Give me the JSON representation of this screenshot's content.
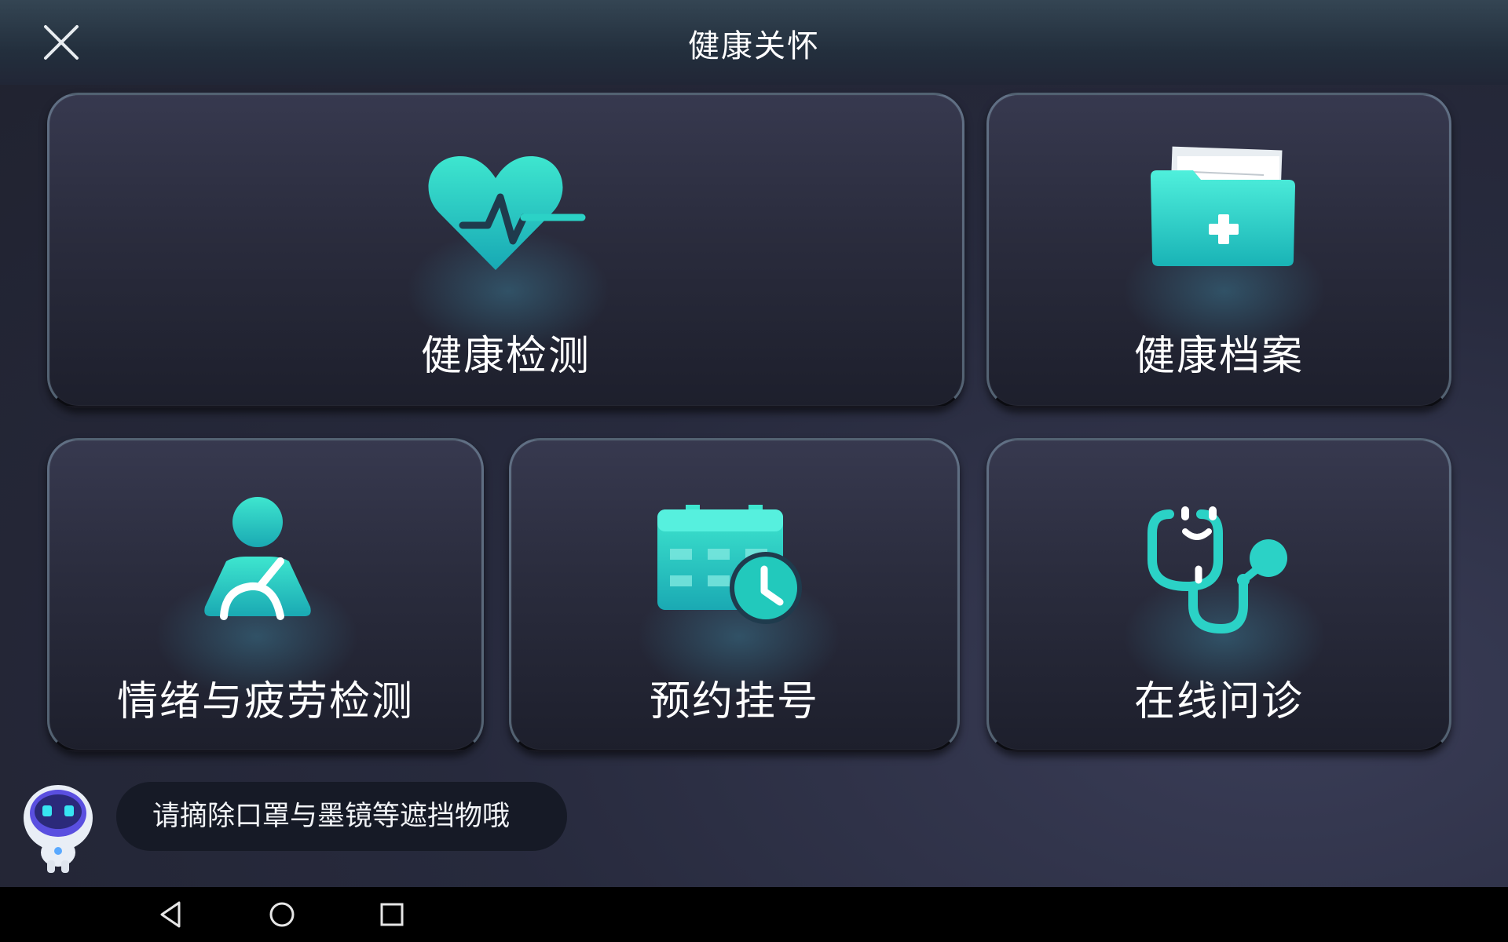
{
  "header": {
    "title": "健康关怀",
    "close_icon": "close-icon"
  },
  "cards": {
    "health_check": {
      "label": "健康检测",
      "icon": "heart-pulse-icon"
    },
    "health_record": {
      "label": "健康档案",
      "icon": "medical-folder-icon"
    },
    "mood_fatigue": {
      "label": "情绪与疲劳检测",
      "icon": "person-icon"
    },
    "appointment": {
      "label": "预约挂号",
      "icon": "calendar-clock-icon"
    },
    "online_consult": {
      "label": "在线问诊",
      "icon": "stethoscope-icon"
    }
  },
  "assistant": {
    "icon": "robot-assistant-icon",
    "message": "请摘除口罩与墨镜等遮挡物哦"
  },
  "navigation_bar": {
    "back": "back-triangle-icon",
    "home": "home-circle-icon",
    "recents": "recents-square-icon"
  },
  "colors": {
    "accent": "#2fd6c4",
    "background": "#272a3d",
    "card": "#2a2c3d",
    "bubble": "#161a26"
  }
}
